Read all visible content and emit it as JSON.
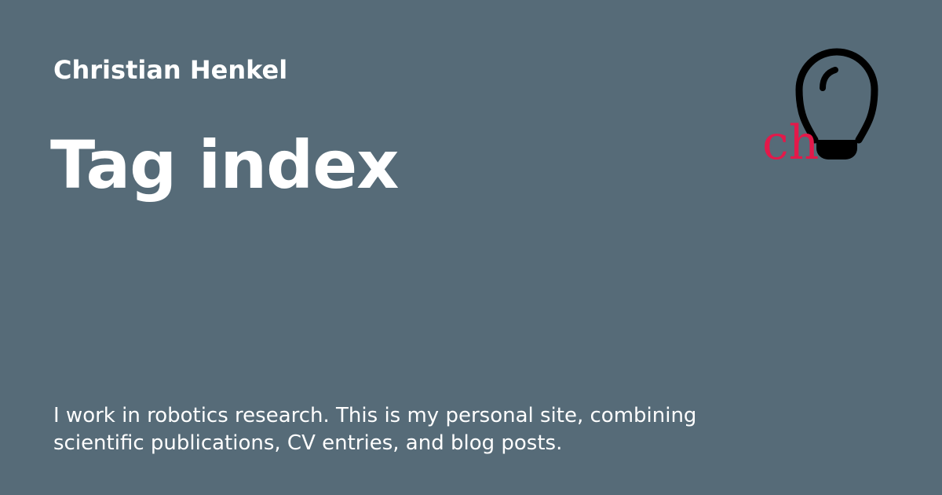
{
  "site": {
    "name": "Christian Henkel"
  },
  "page": {
    "title": "Tag index"
  },
  "description": {
    "lines": [
      "I work in robotics research. This is my personal site, combining",
      "scientific publications, CV entries, and blog posts."
    ]
  },
  "logo": {
    "text": "ch",
    "icon": "lightbulb-icon",
    "text_color": "#e3194a",
    "icon_color": "#000000"
  },
  "colors": {
    "background": "#566b78",
    "text": "#ffffff"
  }
}
